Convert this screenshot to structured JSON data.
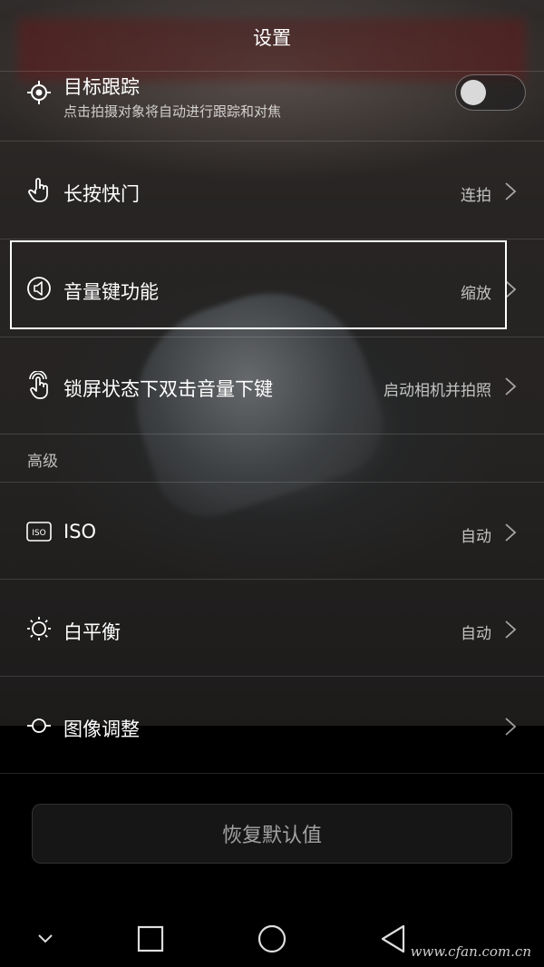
{
  "header": {
    "title": "设置"
  },
  "settings": [
    {
      "label": "目标跟踪",
      "sub": "点击拍摄对象将自动进行跟踪和对焦",
      "toggle_on": false,
      "icon": "target-icon"
    },
    {
      "label": "长按快门",
      "value": "连拍",
      "icon": "hand-press-icon"
    },
    {
      "label": "音量键功能",
      "value": "缩放",
      "icon": "volume-icon"
    },
    {
      "label": "锁屏状态下双击音量下键",
      "value": "启动相机并拍照",
      "icon": "double-tap-icon"
    }
  ],
  "advanced": {
    "header": "高级",
    "items": [
      {
        "label": "ISO",
        "value": "自动",
        "icon": "iso-icon"
      },
      {
        "label": "白平衡",
        "value": "自动",
        "icon": "sun-icon"
      },
      {
        "label": "图像调整",
        "value": "",
        "icon": "image-adjust-icon"
      }
    ]
  },
  "reset_button": "恢复默认值",
  "navbar": [
    "chevron-down-icon",
    "recent-apps-icon",
    "home-icon",
    "back-icon"
  ],
  "watermark": "www.cfan.com.cn",
  "colors": {
    "highlight": "#ffffff",
    "background": "#000000"
  }
}
